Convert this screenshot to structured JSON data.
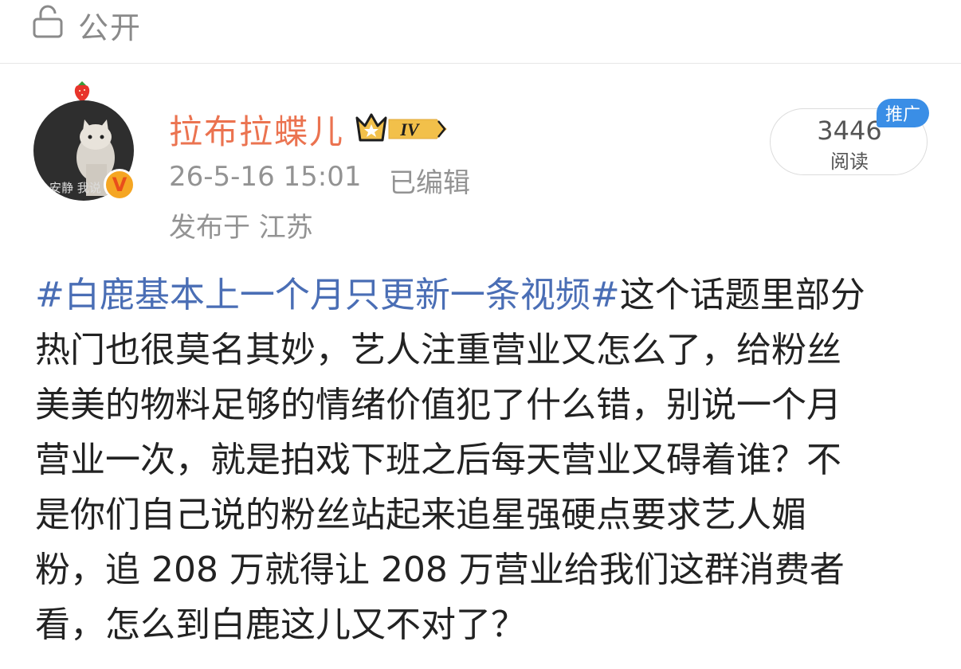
{
  "header": {
    "visibility_label": "公开",
    "icon": "lock-icon"
  },
  "author": {
    "name": "拉布拉蝶儿",
    "level_badge": "IV",
    "verified_badge": "V",
    "avatar_caption": "安静 我说",
    "time": "26-5-16 15:01",
    "edited": "已编辑",
    "location": "发布于 江苏"
  },
  "stats": {
    "reads_count": "3446",
    "reads_label": "阅读",
    "promo_tag": "推广"
  },
  "post": {
    "hashtag": "#白鹿基本上一个月只更新一条视频#",
    "line1_rest": "这个话题里部分",
    "lines": [
      "热门也很莫名其妙，艺人注重营业又怎么了，给粉丝",
      "美美的物料足够的情绪价值犯了什么错，别说一个月",
      "营业一次，就是拍戏下班之后每天营业又碍着谁？不",
      "是你们自己说的粉丝站起来追星强硬点要求艺人媚",
      "粉，追 208 万就得让 208 万营业给我们这群消费者",
      "看，怎么到白鹿这儿又不对了？"
    ]
  },
  "colors": {
    "username": "#eb7350",
    "hashtag": "#4a6eb5",
    "muted": "#939393",
    "promo": "#3a8ee6",
    "badge": "#f5a623"
  }
}
